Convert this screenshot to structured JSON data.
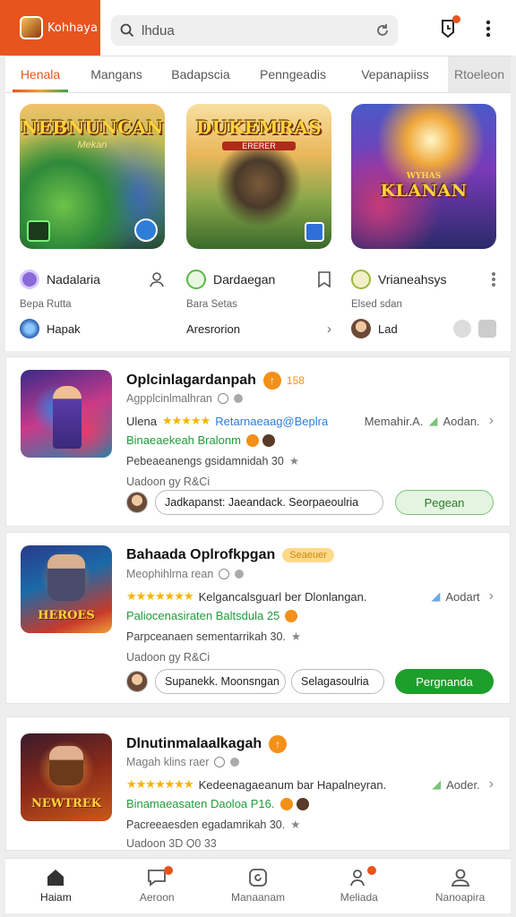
{
  "app": {
    "logo_text": "Kohhaya",
    "search_value": "lhdua",
    "accent": "#e8541e",
    "green": "#1e9e2a"
  },
  "tabs": [
    {
      "label": "Henala",
      "active": true
    },
    {
      "label": "Mangans"
    },
    {
      "label": "Badapscia"
    },
    {
      "label": "Penngeadis"
    },
    {
      "label": "Vepanapiiss"
    },
    {
      "label": "Rtoeleon"
    }
  ],
  "featured": [
    {
      "art_title": "NEBNUNCAN",
      "art_subtitle": "Mekan",
      "name": "Nadalaria",
      "sub": "Bepa Rutta",
      "footer": "Hapak",
      "action_icon": "user-icon"
    },
    {
      "art_title": "DUKEMRAS",
      "art_subtitle": "ERERER",
      "name": "Dardaegan",
      "sub": "Bara Setas",
      "footer": "Aresrorion",
      "action_icon": "bookmark-icon"
    },
    {
      "art_title": "KLANAN",
      "art_subtitle": "WYHAS",
      "name": "Vrianeahsys",
      "sub": "Elsed sdan",
      "footer": "Lad",
      "action_icon": "more-vertical-icon"
    }
  ],
  "list": [
    {
      "title": "Oplcinlagardanpah",
      "badge_label": "158",
      "subtitle": "Agpplcinlmalhran",
      "rating_prefix": "Ulena",
      "rating_desc": "Retarnaeaag@Beplra",
      "rating_more": "Memahir.A.",
      "rating_link": "Aodan.",
      "developer": "Binaeaekeah Bralonm",
      "meta": "Pebeaeanengs gsidamnidah 30",
      "date": "Uadoon gy R&Ci",
      "chip1": "Jadkapanst: Jaeandack. Seorpaeoulria",
      "cta": "Pegean"
    },
    {
      "title": "Bahaada Oplrofkpgan",
      "badge_label": "Seaeuer",
      "subtitle": "Meophihlrna rean",
      "rating_desc": "Kelgancalsguarl ber Dlonlangan.",
      "rating_link": "Aodart",
      "developer": "Paliocenasiraten Baltsdula 25",
      "meta": "Parpceanaen sementarrikah 30.",
      "date": "Uadoon gy R&Ci",
      "chip1": "Supanekk. Moonsngan",
      "chip2": "Selagasoulria",
      "cta": "Pergnanda"
    },
    {
      "title": "Dlnutinmalaalkagah",
      "subtitle": "Magah klins raer",
      "rating_desc": "Kedeenagaeanum bar Hapalneyran.",
      "rating_link": "Aoder.",
      "developer": "Binamaeasaten Daoloa P16.",
      "meta": "Pacreeaesden egadamrikah 30.",
      "date": "Uadoon 3D Q0 33"
    }
  ],
  "bottom_nav": [
    {
      "label": "Haiam",
      "icon": "home-icon",
      "active": true
    },
    {
      "label": "Aeroon",
      "icon": "chat-icon"
    },
    {
      "label": "Manaanam",
      "icon": "store-icon"
    },
    {
      "label": "Meliada",
      "icon": "people-icon"
    },
    {
      "label": "Nanoapira",
      "icon": "profile-icon"
    }
  ]
}
